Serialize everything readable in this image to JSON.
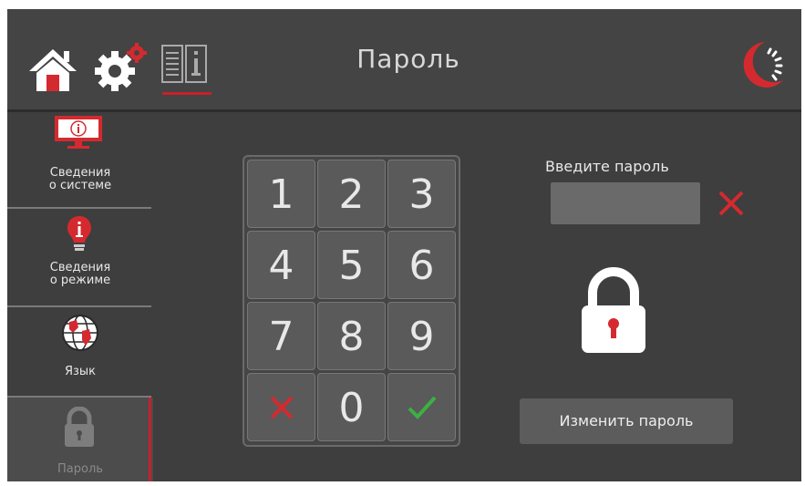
{
  "header": {
    "title": "Пароль",
    "icons": [
      "home-icon",
      "gear-icon",
      "info-book-icon",
      "brand-logo-icon"
    ]
  },
  "sidebar": {
    "items": [
      {
        "line1": "Сведения",
        "line2": "о системе",
        "icon": "monitor-info-icon"
      },
      {
        "line1": "Сведения",
        "line2": "о режиме",
        "icon": "bulb-info-icon"
      },
      {
        "line1": "Язык",
        "line2": "",
        "icon": "globe-icon"
      },
      {
        "line1": "Пароль",
        "line2": "",
        "icon": "lock-icon",
        "active": true
      }
    ]
  },
  "keypad": {
    "keys": [
      "1",
      "2",
      "3",
      "4",
      "5",
      "6",
      "7",
      "8",
      "9",
      "",
      "0",
      ""
    ],
    "cancel_icon": "x-icon",
    "confirm_icon": "check-icon"
  },
  "password": {
    "prompt": "Введите пароль",
    "value": "",
    "clear_icon": "x-icon"
  },
  "change_button": {
    "label": "Изменить пароль"
  },
  "colors": {
    "accent": "#c8202a",
    "background": "#3e3e3e",
    "confirm": "#3cb043"
  }
}
